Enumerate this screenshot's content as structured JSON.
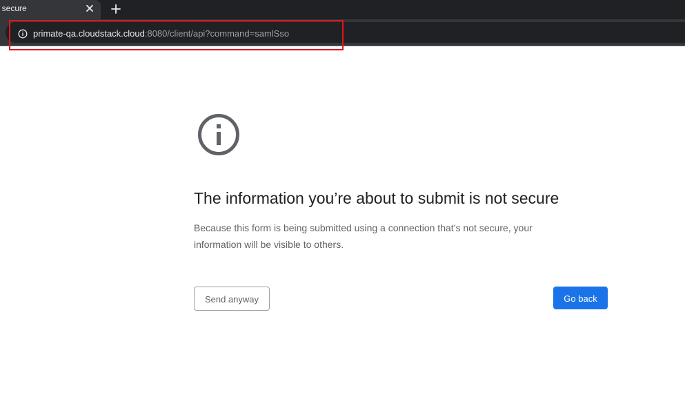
{
  "tab": {
    "title": "t secure",
    "close_icon": "close-icon",
    "new_tab_icon": "plus-icon"
  },
  "address_bar": {
    "site_info_icon": "info-icon",
    "url_host": "primate-qa.cloudstack.cloud",
    "url_rest": ":8080/client/api?command=samlSso"
  },
  "page": {
    "icon": "info-icon",
    "heading": "The information you’re about to submit is not secure",
    "body": "Because this form is being submitted using a connection that’s not secure, your information will be visible to others.",
    "send_anyway_label": "Send anyway",
    "go_back_label": "Go back"
  },
  "colors": {
    "highlight_border": "#e3141b",
    "primary_button": "#1a73e8",
    "tabstrip": "#202124",
    "toolbar": "#35363a"
  }
}
